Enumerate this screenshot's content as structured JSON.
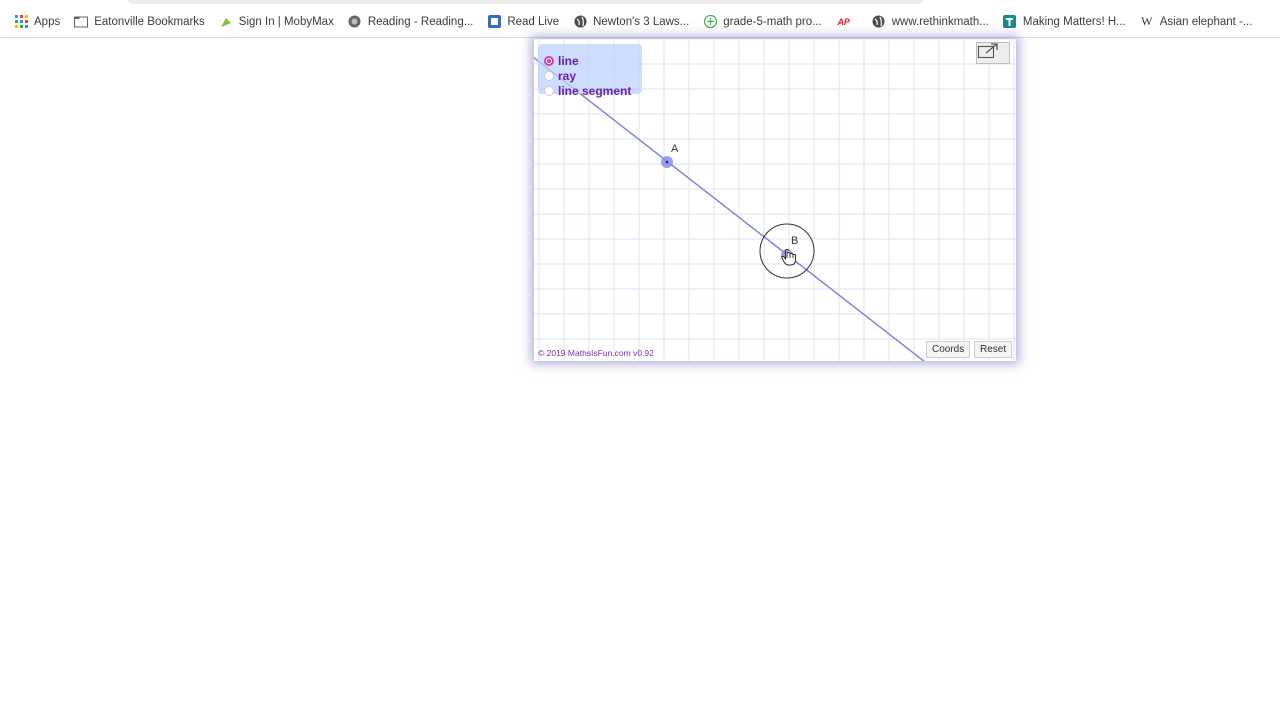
{
  "bookmarks": [
    {
      "label": "Apps",
      "icon": "apps-grid-icon"
    },
    {
      "label": "Eatonville Bookmarks",
      "icon": "folder-icon"
    },
    {
      "label": "Sign In | MobyMax",
      "icon": "mobymax-icon"
    },
    {
      "label": "Reading - Reading...",
      "icon": "reading-icon"
    },
    {
      "label": "Read Live",
      "icon": "read-live-icon"
    },
    {
      "label": "Newton's 3 Laws...",
      "icon": "globe-icon"
    },
    {
      "label": "grade-5-math pro...",
      "icon": "math-icon"
    },
    {
      "label": "",
      "icon": "ap-icon",
      "text": "AP"
    },
    {
      "label": "www.rethinkmath...",
      "icon": "globe-icon"
    },
    {
      "label": "Making Matters! H...",
      "icon": "making-matters-icon"
    },
    {
      "label": "Asian elephant -...",
      "icon": "wikipedia-icon",
      "text": "W"
    }
  ],
  "applet": {
    "modes": [
      {
        "label": "line",
        "selected": true
      },
      {
        "label": "ray",
        "selected": false
      },
      {
        "label": "line segment",
        "selected": false
      }
    ],
    "point_a_label": "A",
    "point_b_label": "B",
    "copyright": "© 2019 MathsIsFun.com v0.92",
    "coords_button": "Coords",
    "reset_button": "Reset",
    "colors": {
      "line": "#7b7be6",
      "point": "#8c8cf0",
      "grid": "#e2e2f4",
      "mode_text": "#6a1fb0"
    }
  }
}
